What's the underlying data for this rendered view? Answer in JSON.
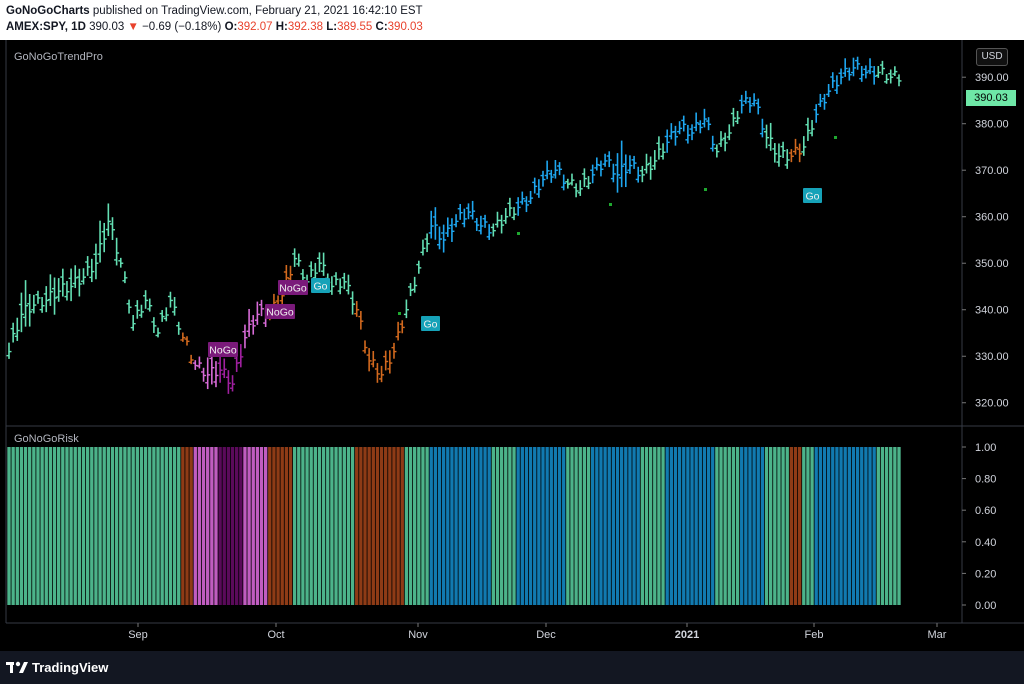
{
  "header": {
    "publisher": "GoNoGoCharts",
    "published_text": "published on TradingView.com, February 21, 2021 16:42:10 EST",
    "symbol": "AMEX:SPY, 1D",
    "last": "390.03",
    "change_arrow": "▼",
    "change": "−0.69 (−0.18%)",
    "o_label": "O:",
    "o_value": "392.07",
    "h_label": "H:",
    "h_value": "392.38",
    "l_label": "L:",
    "l_value": "389.55",
    "c_label": "C:",
    "c_value": "390.03"
  },
  "top_pane": {
    "title": "GoNoGoTrendPro",
    "currency_button": "USD",
    "last_price_tag": "390.03"
  },
  "bottom_pane": {
    "title": "GoNoGoRisk"
  },
  "footer": {
    "brand": "TradingView"
  },
  "colors": {
    "bright_blue": "#1ea7f0",
    "aqua": "#64e0b4",
    "orange": "#d2691e",
    "pink": "#d86bd8",
    "purple": "#a020a0",
    "dark_purple": "#5a0a5a",
    "risk_blue": "#117ab0",
    "risk_green": "#4cb38a",
    "risk_orange": "#8e3b16",
    "risk_pink": "#c05cc0",
    "risk_purple": "#5a0a5a",
    "go_label_bg": "#16a2b8",
    "nogo_label_bg": "#7a1a7a"
  },
  "chart_data": [
    {
      "type": "bar",
      "subtype": "ohlc",
      "title": "GoNoGoTrendPro",
      "symbol": "SPY",
      "y_range": [
        315,
        398
      ],
      "y_ticks": [
        "320.00",
        "330.00",
        "340.00",
        "350.00",
        "360.00",
        "370.00",
        "380.00",
        "390.00"
      ],
      "x_ticks": [
        "Sep",
        "Oct",
        "Nov",
        "Dec",
        "2021",
        "Feb",
        "Mar"
      ],
      "annotations": [
        {
          "text": "NoGo",
          "approx_date": "2020-09-23"
        },
        {
          "text": "NoGo",
          "approx_date": "2020-10-05"
        },
        {
          "text": "NoGo",
          "approx_date": "2020-10-08"
        },
        {
          "text": "Go",
          "approx_date": "2020-10-12"
        },
        {
          "text": "Go",
          "approx_date": "2020-11-05"
        },
        {
          "text": "Go",
          "approx_date": "2021-02-01"
        }
      ],
      "segments": [
        {
          "color": "aqua",
          "points": [
            [
              331,
              5
            ],
            [
              339,
              10
            ],
            [
              341,
              4
            ],
            [
              342,
              8
            ],
            [
              344,
              6
            ],
            [
              345,
              7
            ],
            [
              347,
              5
            ],
            [
              350,
              9
            ],
            [
              359,
              7
            ]
          ]
        },
        {
          "color": "aqua",
          "points": [
            [
              350,
              3
            ],
            [
              337,
              4
            ],
            [
              342,
              4
            ],
            [
              335,
              3
            ],
            [
              342,
              4
            ]
          ]
        },
        {
          "color": "orange",
          "points": [
            [
              334,
              1
            ]
          ]
        },
        {
          "color": "pink",
          "points": [
            [
              328,
              3
            ],
            [
              326,
              8
            ]
          ]
        },
        {
          "color": "purple",
          "points": [
            [
              327,
              6
            ],
            [
              324,
              5
            ]
          ]
        },
        {
          "color": "pink",
          "points": [
            [
              334,
              6
            ],
            [
              339,
              5
            ]
          ]
        },
        {
          "color": "orange",
          "points": [
            [
              339,
              4
            ],
            [
              343,
              5
            ]
          ]
        },
        {
          "color": "aqua",
          "points": [
            [
              351,
              4
            ],
            [
              346,
              4
            ],
            [
              350,
              5
            ],
            [
              345,
              4
            ],
            [
              346,
              5
            ]
          ]
        },
        {
          "color": "orange",
          "points": [
            [
              340,
              4
            ]
          ]
        },
        {
          "color": "orange",
          "points": [
            [
              329,
              5
            ],
            [
              326,
              5
            ],
            [
              331,
              4
            ]
          ]
        },
        {
          "color": "aqua",
          "points": [
            [
              340,
              4
            ],
            [
              349,
              4
            ]
          ]
        },
        {
          "color": "blue",
          "points": [
            [
              358,
              7
            ],
            [
              355,
              6
            ],
            [
              359,
              4
            ],
            [
              361,
              4
            ],
            [
              358,
              4
            ]
          ]
        },
        {
          "color": "aqua",
          "points": [
            [
              357,
              4
            ],
            [
              360,
              4
            ]
          ]
        },
        {
          "color": "blue",
          "points": [
            [
              362,
              4
            ],
            [
              364,
              4
            ],
            [
              368,
              4
            ],
            [
              370,
              4
            ]
          ]
        },
        {
          "color": "aqua",
          "points": [
            [
              367,
              3
            ],
            [
              366,
              4
            ]
          ]
        },
        {
          "color": "blue",
          "points": [
            [
              369,
              4
            ],
            [
              372,
              4
            ],
            [
              369,
              10
            ],
            [
              371,
              4
            ]
          ]
        },
        {
          "color": "aqua",
          "points": [
            [
              369,
              5
            ],
            [
              372,
              5
            ]
          ]
        },
        {
          "color": "blue",
          "points": [
            [
              376,
              5
            ],
            [
              379,
              4
            ],
            [
              378,
              4
            ],
            [
              381,
              4
            ]
          ]
        },
        {
          "color": "aqua",
          "points": [
            [
              374,
              4
            ],
            [
              378,
              4
            ]
          ]
        },
        {
          "color": "blue",
          "points": [
            [
              384,
              4
            ],
            [
              385,
              4
            ]
          ]
        },
        {
          "color": "aqua",
          "points": [
            [
              377,
              6
            ],
            [
              373,
              5
            ]
          ]
        },
        {
          "color": "orange",
          "points": [
            [
              373,
              4
            ]
          ]
        },
        {
          "color": "aqua",
          "points": [
            [
              375,
              5
            ]
          ]
        },
        {
          "color": "blue",
          "points": [
            [
              382,
              4
            ],
            [
              387,
              4
            ],
            [
              390,
              4
            ],
            [
              392,
              4
            ],
            [
              391,
              4
            ]
          ]
        },
        {
          "color": "aqua",
          "points": [
            [
              391,
              3
            ],
            [
              390,
              3
            ]
          ]
        }
      ]
    },
    {
      "type": "bar",
      "title": "GoNoGoRisk",
      "y_range": [
        0,
        1.1
      ],
      "y_ticks": [
        "0.00",
        "0.20",
        "0.40",
        "0.60",
        "0.80",
        "1.00"
      ],
      "values_all": 1.0,
      "color_sequence": "Bar colors follow the trend state of the price bar above"
    }
  ]
}
